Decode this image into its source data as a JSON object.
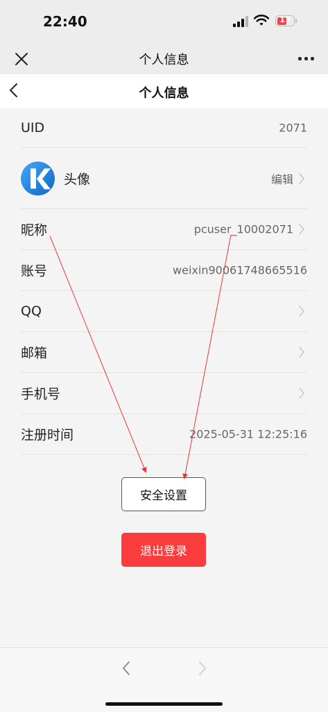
{
  "status_bar": {
    "time": "22:40",
    "battery": "17"
  },
  "mini_program_bar": {
    "title": "个人信息"
  },
  "page": {
    "title": "个人信息"
  },
  "rows": {
    "uid": {
      "label": "UID",
      "value": "2071"
    },
    "avatar": {
      "label": "头像",
      "value": "编辑"
    },
    "nickname": {
      "label": "昵称",
      "value": "pcuser_10002071"
    },
    "account": {
      "label": "账号",
      "value": "weixin90061748665516"
    },
    "qq": {
      "label": "QQ",
      "value": ""
    },
    "email": {
      "label": "邮箱",
      "value": ""
    },
    "phone": {
      "label": "手机号",
      "value": ""
    },
    "register_time": {
      "label": "注册时间",
      "value": "2025-05-31 12:25:16"
    }
  },
  "buttons": {
    "security": "安全设置",
    "logout": "退出登录"
  },
  "colors": {
    "logout": "#fa3c3c",
    "annotation_arrow": "#e53935",
    "avatar_blue": "#1e88e5"
  }
}
